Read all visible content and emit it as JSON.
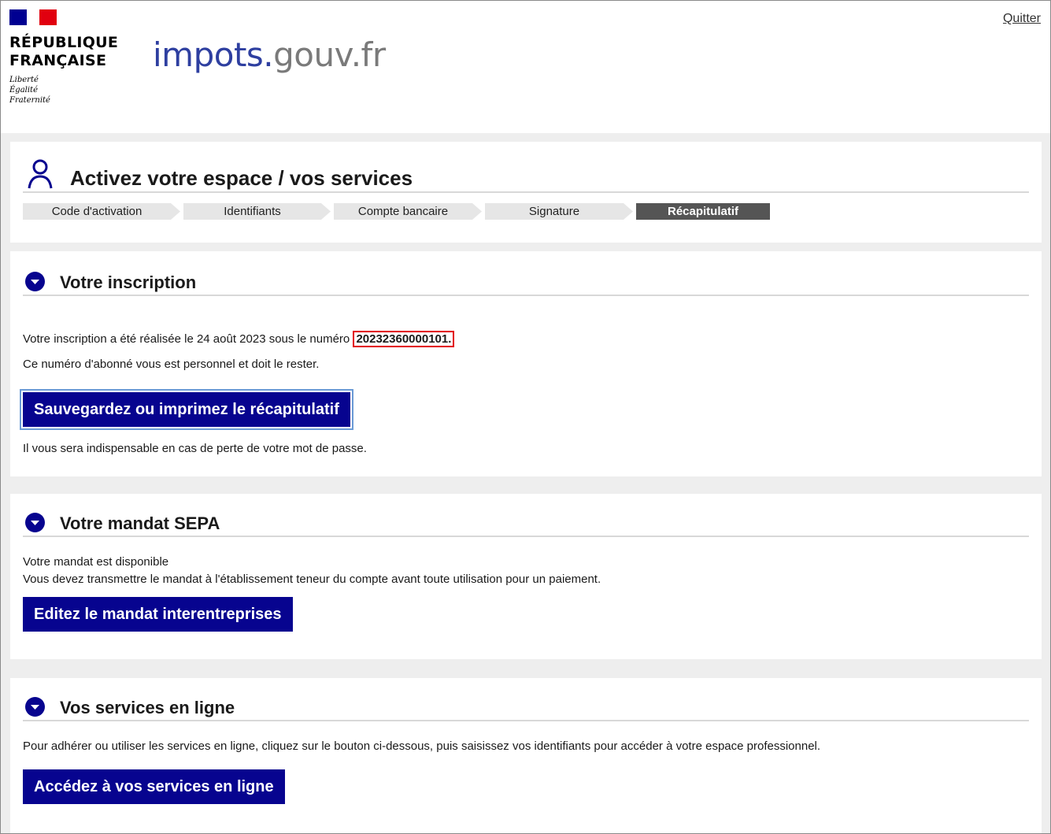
{
  "header": {
    "republic_name": "RÉPUBLIQUE\nFRANÇAISE",
    "motto": "Liberté\nÉgalité\nFraternité",
    "site_logo_part1": "impots.",
    "site_logo_part2": "gouv.fr",
    "quit_label": "Quitter"
  },
  "page_title": "Activez votre espace / vos services",
  "steps": [
    {
      "label": "Code d'activation",
      "active": false
    },
    {
      "label": "Identifiants",
      "active": false
    },
    {
      "label": "Compte bancaire",
      "active": false
    },
    {
      "label": "Signature",
      "active": false
    },
    {
      "label": "Récapitulatif",
      "active": true
    }
  ],
  "inscription": {
    "title": "Votre inscription",
    "line1_prefix": "Votre inscription a été réalisée le 24 août 2023 sous le numéro",
    "number": "20232360000101.",
    "line2": "Ce numéro d'abonné vous est personnel et doit le rester.",
    "button": "Sauvegardez ou imprimez le récapitulatif",
    "line3": "Il vous sera indispensable en cas de perte de votre mot de passe."
  },
  "mandat": {
    "title": "Votre mandat SEPA",
    "line1": "Votre mandat est disponible",
    "line2": "Vous devez transmettre le mandat à l'établissement teneur du compte avant toute utilisation pour un paiement.",
    "button": "Editez le mandat interentreprises"
  },
  "services": {
    "title": "Vos services en ligne",
    "line1": "Pour adhérer ou utiliser les services en ligne, cliquez sur le bouton ci-dessous, puis saisissez vos identifiants pour accéder à votre espace professionnel.",
    "button": "Accédez à vos services en ligne"
  },
  "colors": {
    "primary_button": "#07048f",
    "active_step": "#555555",
    "highlight_border": "#e2000f"
  }
}
